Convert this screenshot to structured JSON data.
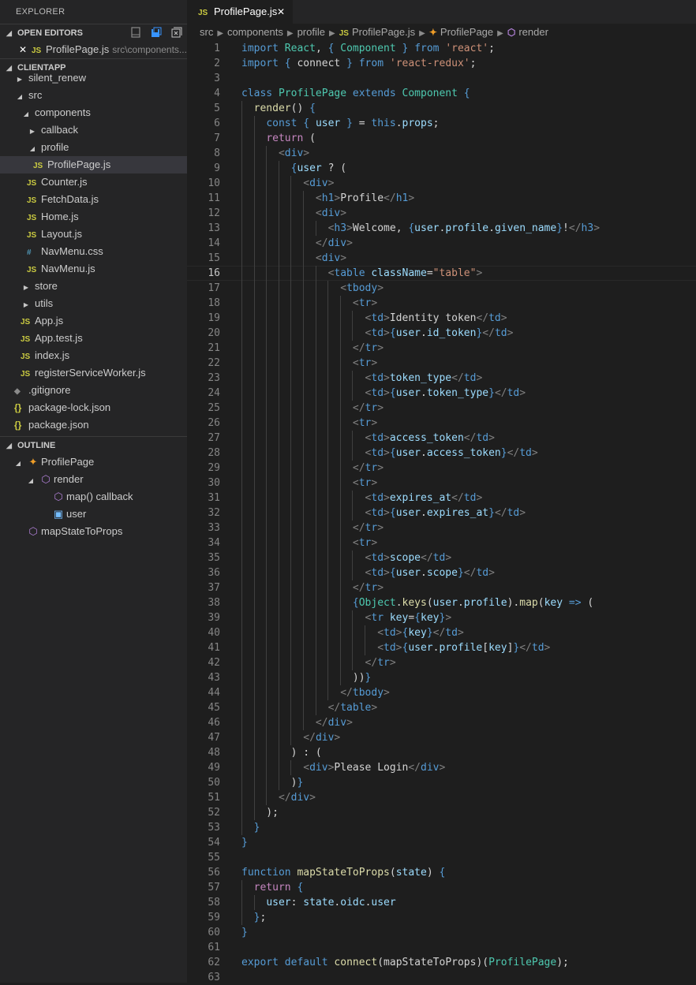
{
  "sidebar": {
    "title": "EXPLORER",
    "open_editors": {
      "label": "OPEN EDITORS",
      "items": [
        {
          "name": "ProfilePage.js",
          "desc": "src\\components..."
        }
      ]
    },
    "project": {
      "label": "CLIENTAPP",
      "tree": [
        {
          "label": "silent_renew",
          "depth": 0,
          "kind": "folder",
          "state": "collapsed"
        },
        {
          "label": "src",
          "depth": 0,
          "kind": "folder",
          "state": "expanded"
        },
        {
          "label": "components",
          "depth": 1,
          "kind": "folder",
          "state": "expanded"
        },
        {
          "label": "callback",
          "depth": 2,
          "kind": "folder",
          "state": "collapsed"
        },
        {
          "label": "profile",
          "depth": 2,
          "kind": "folder",
          "state": "expanded"
        },
        {
          "label": "ProfilePage.js",
          "depth": 3,
          "kind": "js",
          "selected": true
        },
        {
          "label": "Counter.js",
          "depth": 2,
          "kind": "js"
        },
        {
          "label": "FetchData.js",
          "depth": 2,
          "kind": "js"
        },
        {
          "label": "Home.js",
          "depth": 2,
          "kind": "js"
        },
        {
          "label": "Layout.js",
          "depth": 2,
          "kind": "js"
        },
        {
          "label": "NavMenu.css",
          "depth": 2,
          "kind": "css"
        },
        {
          "label": "NavMenu.js",
          "depth": 2,
          "kind": "js"
        },
        {
          "label": "store",
          "depth": 1,
          "kind": "folder",
          "state": "collapsed"
        },
        {
          "label": "utils",
          "depth": 1,
          "kind": "folder",
          "state": "collapsed"
        },
        {
          "label": "App.js",
          "depth": 1,
          "kind": "js"
        },
        {
          "label": "App.test.js",
          "depth": 1,
          "kind": "js"
        },
        {
          "label": "index.js",
          "depth": 1,
          "kind": "js"
        },
        {
          "label": "registerServiceWorker.js",
          "depth": 1,
          "kind": "js"
        },
        {
          "label": ".gitignore",
          "depth": 0,
          "kind": "git"
        },
        {
          "label": "package-lock.json",
          "depth": 0,
          "kind": "json"
        },
        {
          "label": "package.json",
          "depth": 0,
          "kind": "json"
        }
      ]
    },
    "outline": {
      "label": "OUTLINE",
      "items": [
        {
          "label": "ProfilePage",
          "depth": 0,
          "icon": "class",
          "state": "expanded"
        },
        {
          "label": "render",
          "depth": 1,
          "icon": "method",
          "state": "expanded"
        },
        {
          "label": "map() callback",
          "depth": 2,
          "icon": "method"
        },
        {
          "label": "user",
          "depth": 2,
          "icon": "variable"
        },
        {
          "label": "mapStateToProps",
          "depth": 0,
          "icon": "method"
        }
      ]
    }
  },
  "tab": {
    "label": "ProfilePage.js",
    "icon": "JS"
  },
  "breadcrumb": [
    "src",
    "components",
    "profile",
    "ProfilePage.js",
    "ProfilePage",
    "render"
  ],
  "editor": {
    "current_line": 16,
    "lines": [
      "import React, { Component } from 'react';",
      "import { connect } from 'react-redux';",
      "",
      "class ProfilePage extends Component {",
      "  render() {",
      "    const { user } = this.props;",
      "    return (",
      "      <div>",
      "        {user ? (",
      "          <div>",
      "            <h1>Profile</h1>",
      "            <div>",
      "              <h3>Welcome, {user.profile.given_name}!</h3>",
      "            </div>",
      "            <div>",
      "              <table className=\"table\">",
      "                <tbody>",
      "                  <tr>",
      "                    <td>Identity token</td>",
      "                    <td>{user.id_token}</td>",
      "                  </tr>",
      "                  <tr>",
      "                    <td>token_type</td>",
      "                    <td>{user.token_type}</td>",
      "                  </tr>",
      "                  <tr>",
      "                    <td>access_token</td>",
      "                    <td>{user.access_token}</td>",
      "                  </tr>",
      "                  <tr>",
      "                    <td>expires_at</td>",
      "                    <td>{user.expires_at}</td>",
      "                  </tr>",
      "                  <tr>",
      "                    <td>scope</td>",
      "                    <td>{user.scope}</td>",
      "                  </tr>",
      "                  {Object.keys(user.profile).map(key => (",
      "                    <tr key={key}>",
      "                      <td>{key}</td>",
      "                      <td>{user.profile[key]}</td>",
      "                    </tr>",
      "                  ))}",
      "                </tbody>",
      "              </table>",
      "            </div>",
      "          </div>",
      "        ) : (",
      "          <div>Please Login</div>",
      "        )}",
      "      </div>",
      "    );",
      "  }",
      "}",
      "",
      "function mapStateToProps(state) {",
      "  return {",
      "    user: state.oidc.user",
      "  };",
      "}",
      "",
      "export default connect(mapStateToProps)(ProfilePage);",
      ""
    ]
  }
}
